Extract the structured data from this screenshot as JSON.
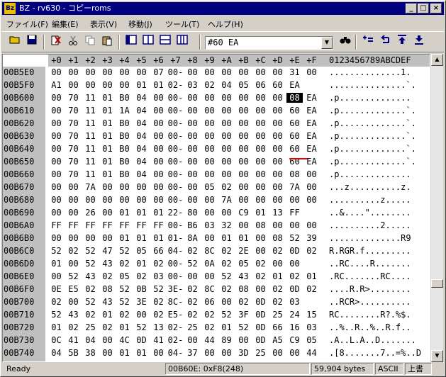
{
  "window": {
    "title": "BZ - rv630 - コピーroms",
    "icon_label": "Bz"
  },
  "menu": [
    "ファイル(F)",
    "編集(E)",
    "表示(V)",
    "移動(J)",
    "ツール(T)",
    "ヘルプ(H)"
  ],
  "toolbar": {
    "address_value": "#60 EA"
  },
  "hex": {
    "col_headers": [
      "+0",
      "+1",
      "+2",
      "+3",
      "+4",
      "+5",
      "+6",
      "+7",
      "+8",
      "+9",
      "+A",
      "+B",
      "+C",
      "+D",
      "+E",
      "+F"
    ],
    "ascii_header": "0123456789ABCDEF",
    "rows": [
      {
        "off": "00B5E0",
        "bytes": [
          "00",
          "00",
          "00",
          "00",
          "00",
          "00",
          "07",
          "00-",
          "00",
          "00",
          "00",
          "00",
          "00",
          "00",
          "31",
          "00"
        ],
        "ascii": "..............1."
      },
      {
        "off": "00B5F0",
        "bytes": [
          "A1",
          "00",
          "00",
          "00",
          "00",
          "01",
          "01",
          "02-",
          "03",
          "02",
          "04",
          "05",
          "06",
          "60",
          "EA",
          ""
        ],
        "ascii": "...............`."
      },
      {
        "off": "00B600",
        "bytes": [
          "00",
          "70",
          "11",
          "01",
          "B0",
          "04",
          "00",
          "00-",
          "00",
          "00",
          "00",
          "00",
          "00",
          "00",
          "08",
          "EA"
        ],
        "ascii": ".p.............."
      },
      {
        "off": "00B610",
        "bytes": [
          "00",
          "70",
          "11",
          "01",
          "1A",
          "04",
          "00",
          "00-",
          "00",
          "00",
          "00",
          "00",
          "00",
          "00",
          "60",
          "EA"
        ],
        "ascii": ".p.............`."
      },
      {
        "off": "00B620",
        "bytes": [
          "00",
          "70",
          "11",
          "01",
          "B0",
          "04",
          "00",
          "00-",
          "00",
          "00",
          "00",
          "00",
          "00",
          "00",
          "60",
          "EA"
        ],
        "ascii": ".p.............`."
      },
      {
        "off": "00B630",
        "bytes": [
          "00",
          "70",
          "11",
          "01",
          "B0",
          "04",
          "00",
          "00-",
          "00",
          "00",
          "00",
          "00",
          "00",
          "00",
          "60",
          "EA"
        ],
        "ascii": ".p.............`."
      },
      {
        "off": "00B640",
        "bytes": [
          "00",
          "70",
          "11",
          "01",
          "B0",
          "04",
          "00",
          "00-",
          "00",
          "00",
          "00",
          "00",
          "00",
          "00",
          "60",
          "EA"
        ],
        "ascii": ".p.............`."
      },
      {
        "off": "00B650",
        "bytes": [
          "00",
          "70",
          "11",
          "01",
          "B0",
          "04",
          "00",
          "00-",
          "00",
          "00",
          "00",
          "00",
          "00",
          "00",
          "60",
          "EA"
        ],
        "ascii": ".p.............`."
      },
      {
        "off": "00B660",
        "bytes": [
          "00",
          "70",
          "11",
          "01",
          "B0",
          "04",
          "00",
          "00-",
          "00",
          "00",
          "00",
          "00",
          "00",
          "00",
          "08",
          "00"
        ],
        "ascii": ".p.............."
      },
      {
        "off": "00B670",
        "bytes": [
          "00",
          "00",
          "7A",
          "00",
          "00",
          "00",
          "00",
          "00-",
          "00",
          "05",
          "02",
          "00",
          "00",
          "00",
          "7A",
          "00"
        ],
        "ascii": "...z..........z."
      },
      {
        "off": "00B680",
        "bytes": [
          "00",
          "00",
          "00",
          "00",
          "00",
          "00",
          "00",
          "00-",
          "00",
          "00",
          "7A",
          "00",
          "00",
          "00",
          "00",
          "00"
        ],
        "ascii": "..........z....."
      },
      {
        "off": "00B690",
        "bytes": [
          "00",
          "00",
          "26",
          "00",
          "01",
          "01",
          "01",
          "22-",
          "80",
          "00",
          "00",
          "C9",
          "01",
          "13",
          "FF",
          ""
        ],
        "ascii": "..&....\"........"
      },
      {
        "off": "00B6A0",
        "bytes": [
          "FF",
          "FF",
          "FF",
          "FF",
          "FF",
          "FF",
          "FF",
          "00-",
          "B6",
          "03",
          "32",
          "00",
          "08",
          "00",
          "00",
          "00"
        ],
        "ascii": "..........2....."
      },
      {
        "off": "00B6B0",
        "bytes": [
          "00",
          "00",
          "00",
          "00",
          "01",
          "01",
          "01",
          "01-",
          "8A",
          "00",
          "01",
          "01",
          "00",
          "08",
          "52",
          "39"
        ],
        "ascii": "..............R9"
      },
      {
        "off": "00B6C0",
        "bytes": [
          "52",
          "02",
          "52",
          "47",
          "52",
          "05",
          "66",
          "04-",
          "02",
          "8C",
          "02",
          "2E",
          "00",
          "02",
          "0D",
          "02"
        ],
        "ascii": "R.RGR.f........."
      },
      {
        "off": "00B6D0",
        "bytes": [
          "01",
          "00",
          "52",
          "43",
          "02",
          "01",
          "02",
          "00-",
          "52",
          "0A",
          "02",
          "05",
          "02",
          "00",
          "00",
          ""
        ],
        "ascii": "..RC....R......."
      },
      {
        "off": "00B6E0",
        "bytes": [
          "00",
          "52",
          "43",
          "02",
          "05",
          "02",
          "03",
          "00-",
          "00",
          "00",
          "52",
          "43",
          "02",
          "01",
          "02",
          "01"
        ],
        "ascii": ".RC.......RC...."
      },
      {
        "off": "00B6F0",
        "bytes": [
          "0E",
          "E5",
          "02",
          "08",
          "52",
          "0B",
          "52",
          "3E-",
          "02",
          "8C",
          "02",
          "08",
          "00",
          "02",
          "0D",
          "02"
        ],
        "ascii": "....R.R>........"
      },
      {
        "off": "00B700",
        "bytes": [
          "02",
          "00",
          "52",
          "43",
          "52",
          "3E",
          "02",
          "8C-",
          "02",
          "06",
          "00",
          "02",
          "0D",
          "02",
          "03",
          ""
        ],
        "ascii": "..RCR>.........."
      },
      {
        "off": "00B710",
        "bytes": [
          "52",
          "43",
          "02",
          "01",
          "02",
          "00",
          "02",
          "E5-",
          "02",
          "02",
          "52",
          "3F",
          "0D",
          "25",
          "24",
          "15"
        ],
        "ascii": "RC........R?.%$."
      },
      {
        "off": "00B720",
        "bytes": [
          "01",
          "02",
          "25",
          "02",
          "01",
          "52",
          "13",
          "02-",
          "25",
          "02",
          "01",
          "52",
          "0D",
          "66",
          "16",
          "03"
        ],
        "ascii": "..%..R..%..R.f.."
      },
      {
        "off": "00B730",
        "bytes": [
          "0C",
          "41",
          "04",
          "00",
          "4C",
          "0D",
          "41",
          "02-",
          "00",
          "44",
          "89",
          "00",
          "0D",
          "A5",
          "C9",
          "05"
        ],
        "ascii": ".A..L.A..D......."
      },
      {
        "off": "00B740",
        "bytes": [
          "04",
          "5B",
          "38",
          "00",
          "01",
          "01",
          "00",
          "04-",
          "37",
          "00",
          "00",
          "3D",
          "25",
          "00",
          "00",
          "44"
        ],
        "ascii": ".[8.......7..=%..D"
      }
    ]
  },
  "status": {
    "ready": "Ready",
    "position": "00B60E: 0xF8(248)",
    "size": "59,904 bytes",
    "charset": "ASCII",
    "mode": "上書"
  },
  "colors": {
    "titlebar": "#000080",
    "header_bg": "#c0c0c0",
    "annotation": "#e00000"
  }
}
